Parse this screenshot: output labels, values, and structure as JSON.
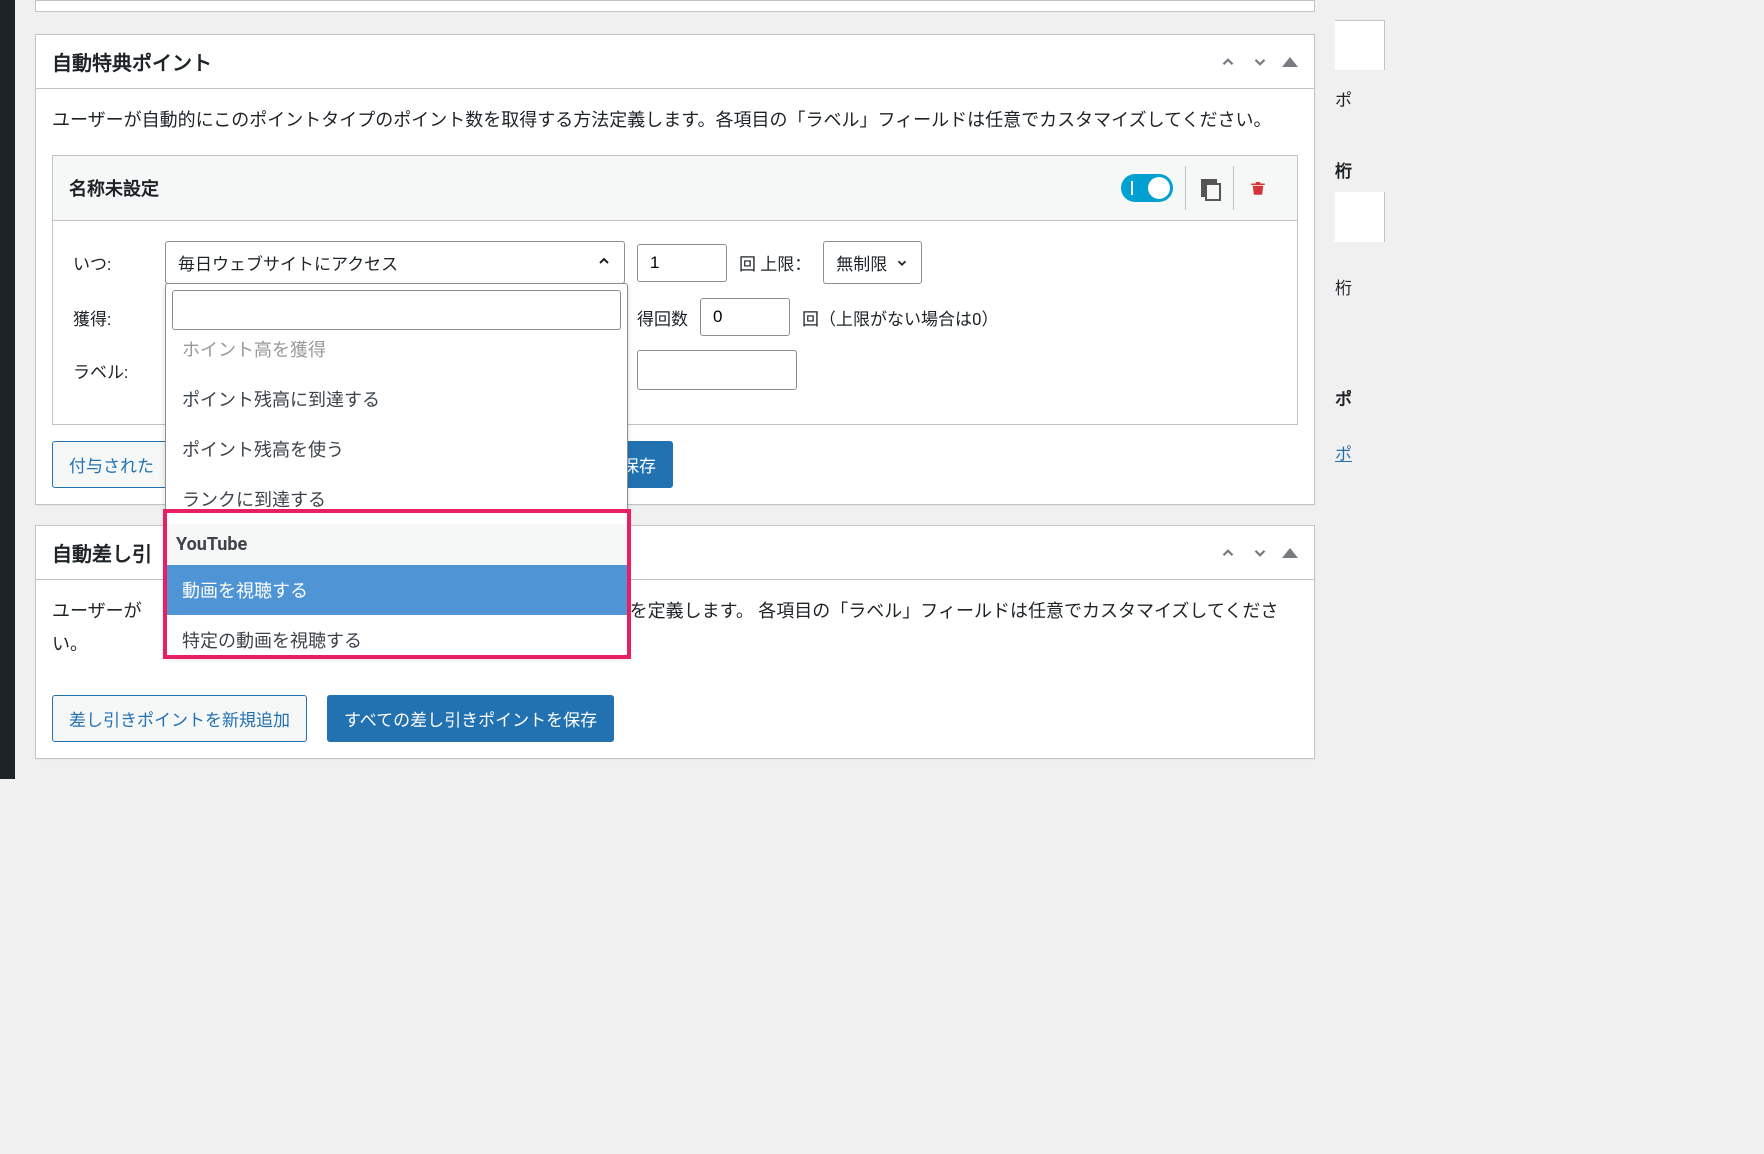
{
  "panel1": {
    "title": "自動特典ポイント",
    "description": "ユーザーが自動的にこのポイントタイプのポイント数を取得する方法定義します。各項目の「ラベル」フィールドは任意でカスタマイズしてください。",
    "config": {
      "title": "名称未設定",
      "when_label": "いつ:",
      "when_value": "毎日ウェブサイトにアクセス",
      "times_value": "1",
      "times_label": "回 上限：",
      "limit_value": "無制限",
      "earn_label": "獲得:",
      "earn_count_label": "得回数",
      "earn_count_value": "0",
      "earn_suffix": "回（上限がない場合は0）",
      "label_label": "ラベル:"
    },
    "dropdown": {
      "partial_item": "ホイント高を獲得",
      "items": [
        "ポイント残高に到達する",
        "ポイント残高を使う",
        "ランクに到達する"
      ],
      "group": "YouTube",
      "group_items": [
        "動画を視聴する",
        "特定の動画を視聴する"
      ],
      "highlighted_index": 0
    },
    "buttons": {
      "add": "付与された",
      "save": "トを保存"
    }
  },
  "panel2": {
    "title": "自動差し引",
    "description_prefix": "ユーザーが",
    "description_suffix": "系を定義します。 各項目の「ラベル」フィールドは任意でカスタマイズしてください。",
    "buttons": {
      "add": "差し引きポイントを新規追加",
      "save": "すべての差し引きポイントを保存"
    }
  },
  "right": {
    "label1": "ポ",
    "label2": "桁",
    "label3": "桁",
    "label4": "ポ",
    "link": "ポ"
  }
}
